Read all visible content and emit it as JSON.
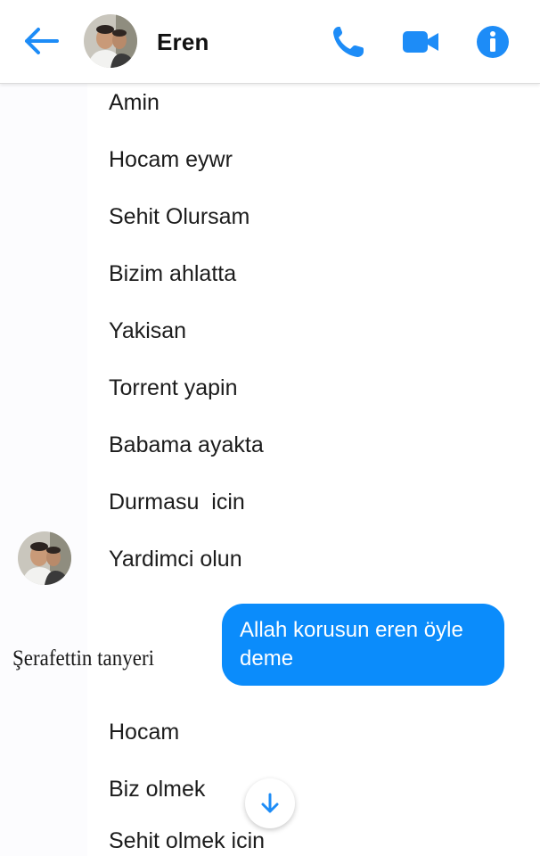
{
  "header": {
    "contact_name": "Eren",
    "icons": {
      "back": "arrow-left-icon",
      "call": "phone-icon",
      "video": "video-camera-icon",
      "info": "info-icon"
    },
    "accent_color": "#1d8cf7"
  },
  "messages": {
    "received": [
      "Amin",
      "Hocam eywr",
      "Sehit Olursam",
      "Bizim ahlatta",
      "Yakisan",
      "Torrent yapin",
      "Babama ayakta",
      "Durmasu  icin",
      "Yardimci olun"
    ],
    "sent": "Allah korusun eren öyle deme",
    "sent_color": "#0b8cfb",
    "received_after": [
      "Hocam",
      "Biz olmek",
      "Sehit olmek icin"
    ]
  },
  "signature": "Şerafettin tanyeri",
  "scroll_button_icon": "arrow-down-icon"
}
